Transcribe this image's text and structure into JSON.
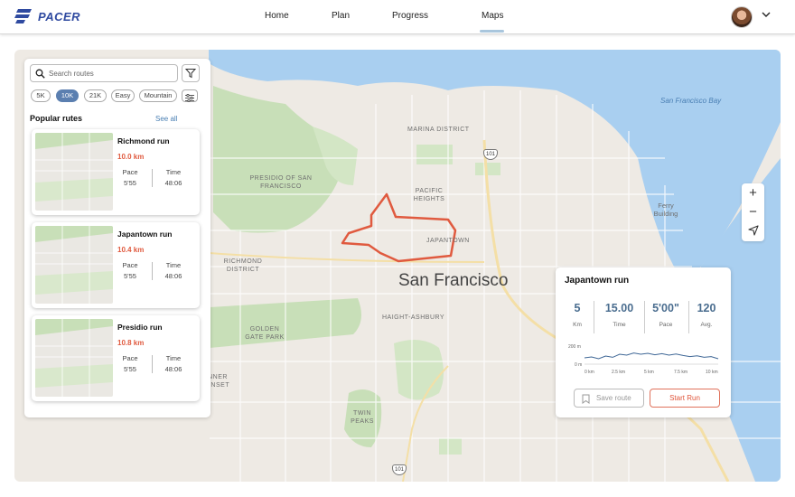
{
  "header": {
    "brand": "PACER",
    "nav": [
      {
        "label": "Home"
      },
      {
        "label": "Plan"
      },
      {
        "label": "Progress"
      },
      {
        "label": "Maps"
      }
    ],
    "active_nav": "Maps",
    "accent_color": "#2f4aa0"
  },
  "map": {
    "city": "San Francisco",
    "labels": {
      "marina": "MARINA DISTRICT",
      "presidio": "PRESIDIO OF SAN FRANCISCO",
      "pacific_heights": "PACIFIC HEIGHTS",
      "japantown": "JAPANTOWN",
      "richmond": "RICHMOND DISTRICT",
      "haight": "HAIGHT-ASHBURY",
      "golden_gate": "GOLDEN GATE PARK",
      "sunset": "NNER UNSET",
      "twin_peaks": "TWIN PEAKS",
      "ferry": "Ferry Building",
      "bay": "San Francisco Bay"
    },
    "highway": "101",
    "route_color": "#e05a3f",
    "zoom_in": "+",
    "zoom_out": "−"
  },
  "panel": {
    "search_placeholder": "Search routes",
    "chips": [
      "5K",
      "10K",
      "21K",
      "Easy",
      "Mountain"
    ],
    "active_chip": "10K",
    "title": "Popular rutes",
    "see_all": "See all",
    "cards": [
      {
        "name": "Richmond run",
        "distance": "10.0 km",
        "pace_label": "Pace",
        "pace": "5'55",
        "time_label": "Time",
        "time": "48:06"
      },
      {
        "name": "Japantown run",
        "distance": "10.4 km",
        "pace_label": "Pace",
        "pace": "5'55",
        "time_label": "Time",
        "time": "48:06"
      },
      {
        "name": "Presidio run",
        "distance": "10.8 km",
        "pace_label": "Pace",
        "pace": "5'55",
        "time_label": "Time",
        "time": "48:06"
      }
    ]
  },
  "popup": {
    "title": "Japantown run",
    "stats": [
      {
        "value": "5",
        "label": "Km"
      },
      {
        "value": "15.00",
        "label": "Time"
      },
      {
        "value": "5'00\"",
        "label": "Pace"
      },
      {
        "value": "120",
        "label": "Avg."
      }
    ],
    "elevation": {
      "y_labels": [
        "200 m",
        "0 m"
      ],
      "x_labels": [
        "0 km",
        "2.5 km",
        "5 km",
        "7.5 km",
        "10 km"
      ],
      "profile": [
        0.35,
        0.4,
        0.3,
        0.45,
        0.38,
        0.55,
        0.5,
        0.62,
        0.55,
        0.6,
        0.52,
        0.58,
        0.5,
        0.56,
        0.48,
        0.42,
        0.46,
        0.38,
        0.42,
        0.3
      ]
    },
    "save_label": "Save route",
    "start_label": "Start Run"
  }
}
